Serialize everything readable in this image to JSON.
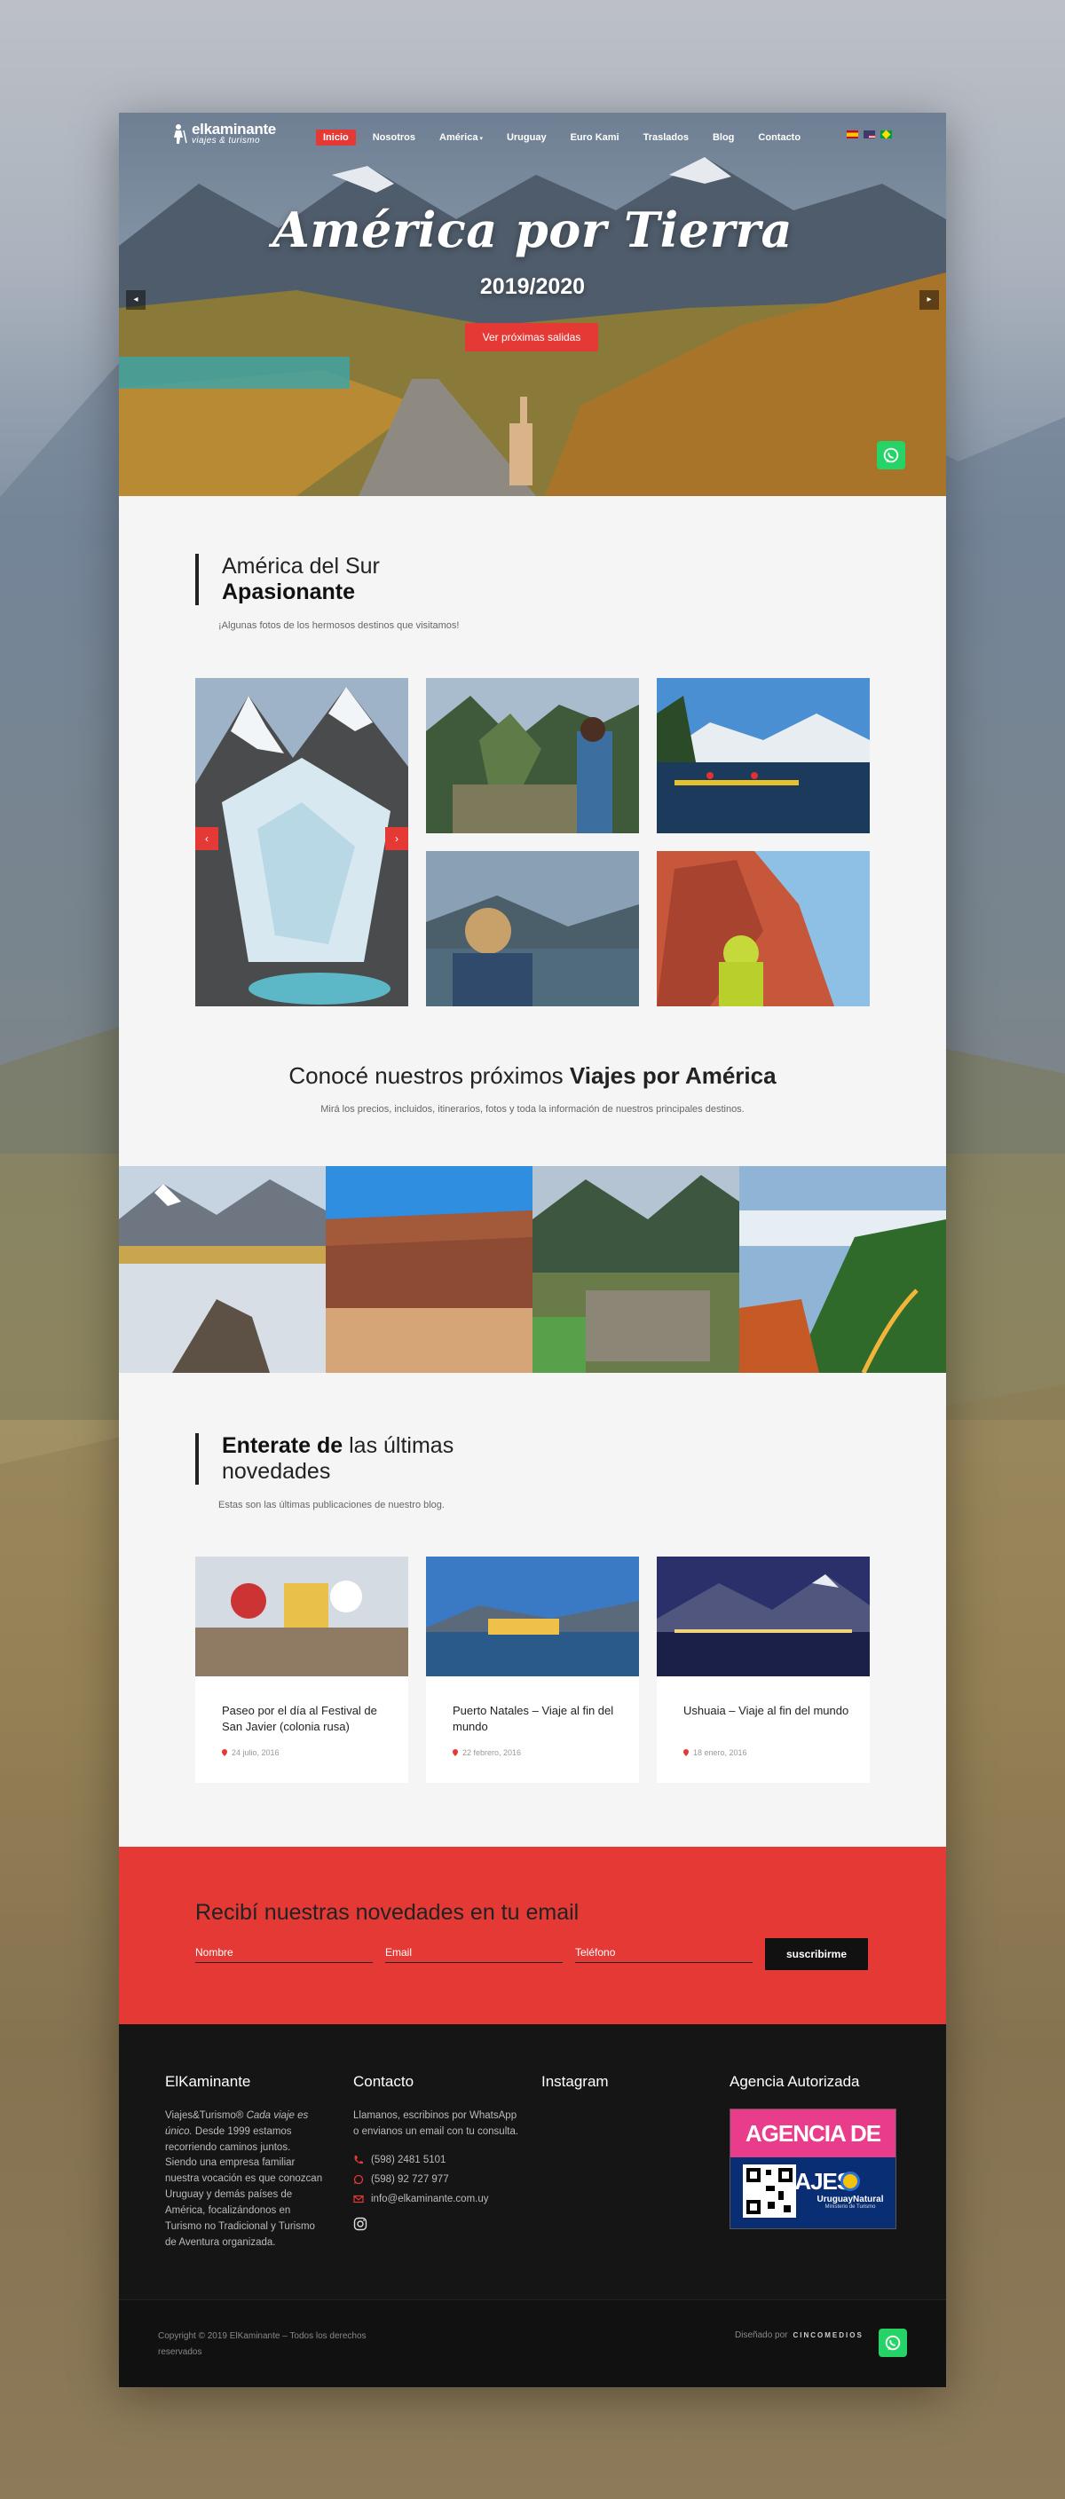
{
  "nav": {
    "logo_name": "elkaminante",
    "logo_sub": "viajes & turismo",
    "items": [
      "Inicio",
      "Nosotros",
      "América",
      "Uruguay",
      "Euro Kami",
      "Traslados",
      "Blog",
      "Contacto"
    ],
    "languages": [
      "es-flag-icon",
      "en-flag-icon",
      "pt-flag-icon"
    ]
  },
  "hero": {
    "title": "América por Tierra",
    "years": "2019/2020",
    "button": "Ver próximas salidas",
    "prev": "◂",
    "next": "▸"
  },
  "gallery_section": {
    "heading_light": "América del Sur",
    "heading_bold": "Apasionante",
    "subtitle": "¡Algunas fotos de los hermosos destinos que visitamos!",
    "prev": "‹",
    "next": "›"
  },
  "trips_section": {
    "title_light": "Conocé nuestros próximos ",
    "title_bold": "Viajes por América",
    "subtitle": "Mirá los precios, incluidos, itinerarios, fotos y toda la información de nuestros principales destinos."
  },
  "blog_section": {
    "heading_bold": "Enterate de",
    "heading_light": " las últimas",
    "heading_line2": "novedades",
    "subtitle": "Estas son las últimas publicaciones de nuestro blog.",
    "posts": [
      {
        "title": "Paseo por el día al Festival de San Javier (colonia rusa)",
        "date": "24 julio, 2016"
      },
      {
        "title": "Puerto Natales – Viaje al fin del mundo",
        "date": "22 febrero, 2016"
      },
      {
        "title": "Ushuaia – Viaje al fin del mundo",
        "date": "18 enero, 2016"
      }
    ]
  },
  "newsletter": {
    "title": "Recibí nuestras novedades en tu email",
    "name_placeholder": "Nombre",
    "email_placeholder": "Email",
    "phone_placeholder": "Teléfono",
    "button": "suscribirme"
  },
  "footer": {
    "col1_title": "ElKaminante",
    "col1_brand": "Viajes&Turismo®",
    "col1_em": " Cada viaje es único.",
    "col1_text": " Desde 1999 estamos recorriendo caminos juntos. Siendo una empresa familiar nuestra vocación es que conozcan Uruguay y demás países de América, focalizándonos en Turismo no Tradicional y Turismo de Aventura organizada.",
    "col2_title": "Contacto",
    "col2_text": "Llamanos, escribinos por WhatsApp o envianos un email con tu consulta.",
    "phone": "(598) 2481 5101",
    "whatsapp": "(598) 92 727 977",
    "email": "info@elkaminante.com.uy",
    "col3_title": "Instagram",
    "col4_title": "Agencia Autorizada",
    "badge_title": "AGENCIA DE VIAJES",
    "badge_brand": "UruguayNatural",
    "badge_sub": "Ministerio de Turismo",
    "copyright": "Copyright © 2019 ElKaminante – Todos los derechos reservados",
    "designed_by": "Diseñado por",
    "designer": "CINCOMEDIOS"
  },
  "colors": {
    "accent": "#e53935",
    "footer": "#151515",
    "whatsapp": "#25d366"
  }
}
